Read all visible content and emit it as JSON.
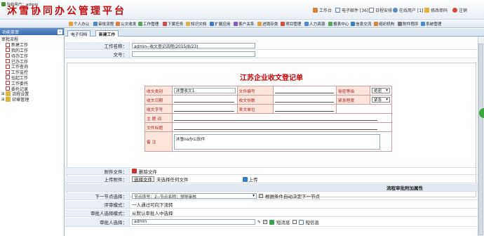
{
  "header": {
    "app_title": "沐雪协同办公管理平台",
    "links": [
      "工作台",
      "电子邮件 [36]",
      "日程安排",
      "在线用户 [1]",
      "修改密码",
      "注销"
    ]
  },
  "toolbar": {
    "user_label": "当前用户：admin",
    "items": [
      "个人办公",
      "审批流程",
      "公文收发",
      "工作管理",
      "下属任务",
      "知识文档",
      "扩展应用",
      "客户关系",
      "进销存类",
      "项目管理",
      "人力资源",
      "报表中心",
      "信息交流",
      "组织机构",
      "附件程序",
      "系统管理"
    ]
  },
  "sidebar": {
    "header": "功能菜单",
    "section": "审批流程",
    "items": [
      "新建工作",
      "我的工作",
      "待办工作",
      "已办工作",
      "工作查询",
      "工作监控",
      "挂起工作",
      "工作委托",
      "委托记录"
    ],
    "groups": [
      "流程设置",
      "印章管理"
    ]
  },
  "tabs": [
    "电子归档",
    "新建工作"
  ],
  "form": {
    "work_name_label": "工作名称：",
    "work_name": "admin--收文登记流程(2015/8/23)",
    "doc_no_label": "文号：",
    "title": "江苏企业收文登记单",
    "grid": {
      "r1": [
        "收文类别",
        "沐雪收文1",
        "文件编号",
        "秘密等级",
        "绝密"
      ],
      "r2": [
        "收文日期",
        "收文份数",
        "紧急程度",
        "紧急"
      ],
      "r3": [
        "收文字号",
        "来文单位"
      ],
      "subject": "主 题 词",
      "file_title": "文件标题",
      "remark": "备  注",
      "remark_value": "沐雪oa办公软件"
    },
    "attachment_label": "附件文件：",
    "delete_attachment": "删除文件",
    "upload_label": "上传附件：",
    "choose_file": "选择文件",
    "no_file": "未选择任何文件",
    "upload": "上传",
    "section_title": "流程审批附加属性",
    "next_step_label": "下一节点选择：",
    "next_step_value": "节点序号：2--节点名称：领导审核",
    "auto_decide": "根据条件自动决定下一节点",
    "review_mode_label": "评审模式：",
    "review_mode": "一人通过可向下流转",
    "approver_mode_label": "审批人选择模式：",
    "approver_mode": "从默认审批人中选择",
    "approver_label": "审批人选择：",
    "approver": "admin",
    "sms": "短消息",
    "mail": "短信息"
  },
  "colors": {
    "title_red": "#c40e0e",
    "accent_blue": "#3c6fae",
    "handle_green": "#3ea63e"
  }
}
